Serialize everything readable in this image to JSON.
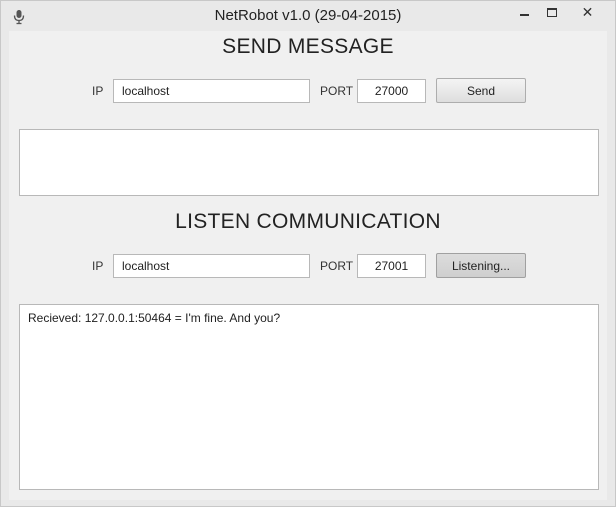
{
  "window": {
    "title": "NetRobot v1.0 (29-04-2015)",
    "minimize_glyph": "",
    "maximize_glyph": "",
    "close_glyph": "✕"
  },
  "send": {
    "heading": "SEND MESSAGE",
    "ip_label": "IP",
    "ip_value": "localhost",
    "port_label": "PORT",
    "port_value": "27000",
    "button_label": "Send",
    "message_text": ""
  },
  "listen": {
    "heading": "LISTEN COMMUNICATION",
    "ip_label": "IP",
    "ip_value": "localhost",
    "port_label": "PORT",
    "port_value": "27001",
    "button_label": "Listening...",
    "log_text": "Recieved: 127.0.0.1:50464 = I'm fine. And you?"
  },
  "icons": {
    "app": "microphone-icon",
    "minimize": "minimize-icon",
    "maximize": "maximize-icon",
    "close": "close-icon"
  }
}
